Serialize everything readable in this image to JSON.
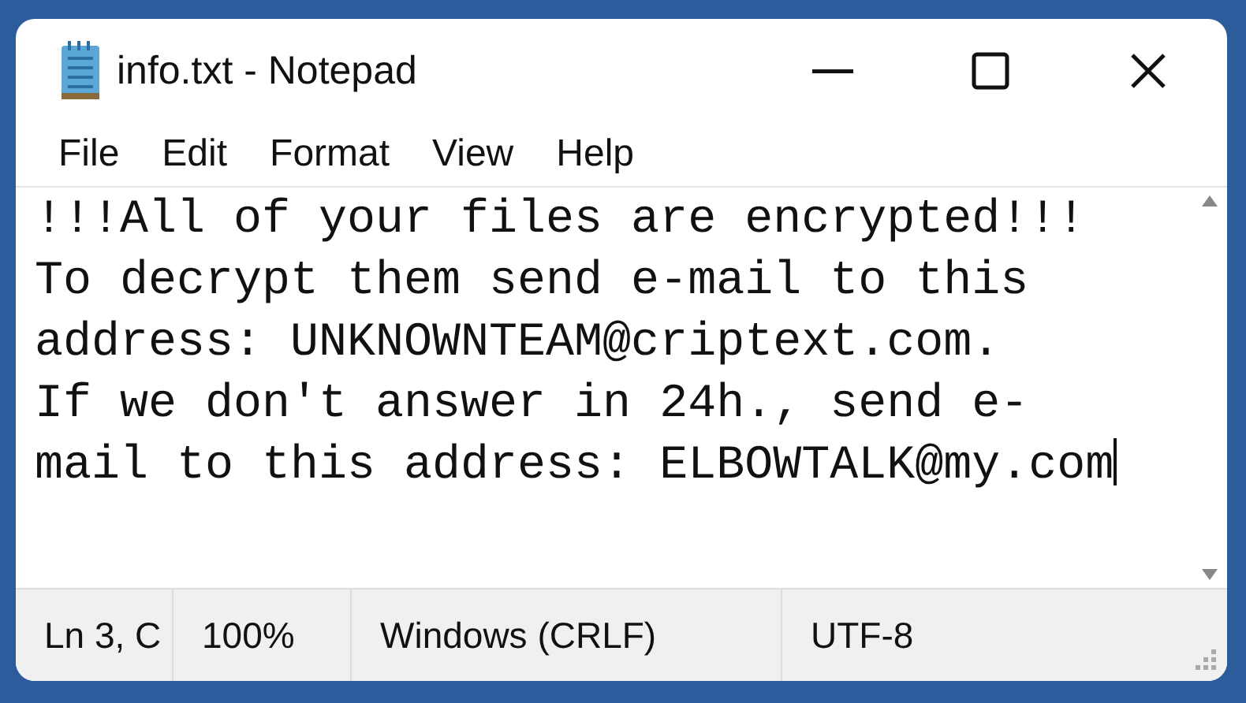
{
  "window": {
    "title": "info.txt - Notepad"
  },
  "menu": [
    "File",
    "Edit",
    "Format",
    "View",
    "Help"
  ],
  "editor": {
    "lines": [
      "!!!All of your files are encrypted!!!",
      "To decrypt them send e-mail to this",
      "address: UNKNOWNTEAM@criptext.com.",
      "If we don't answer in 24h., send e-",
      "mail to this address: ELBOWTALK@my.com"
    ]
  },
  "status_bar": [
    "Ln 3, C",
    "100%",
    "Windows (CRLF)",
    "UTF-8"
  ]
}
